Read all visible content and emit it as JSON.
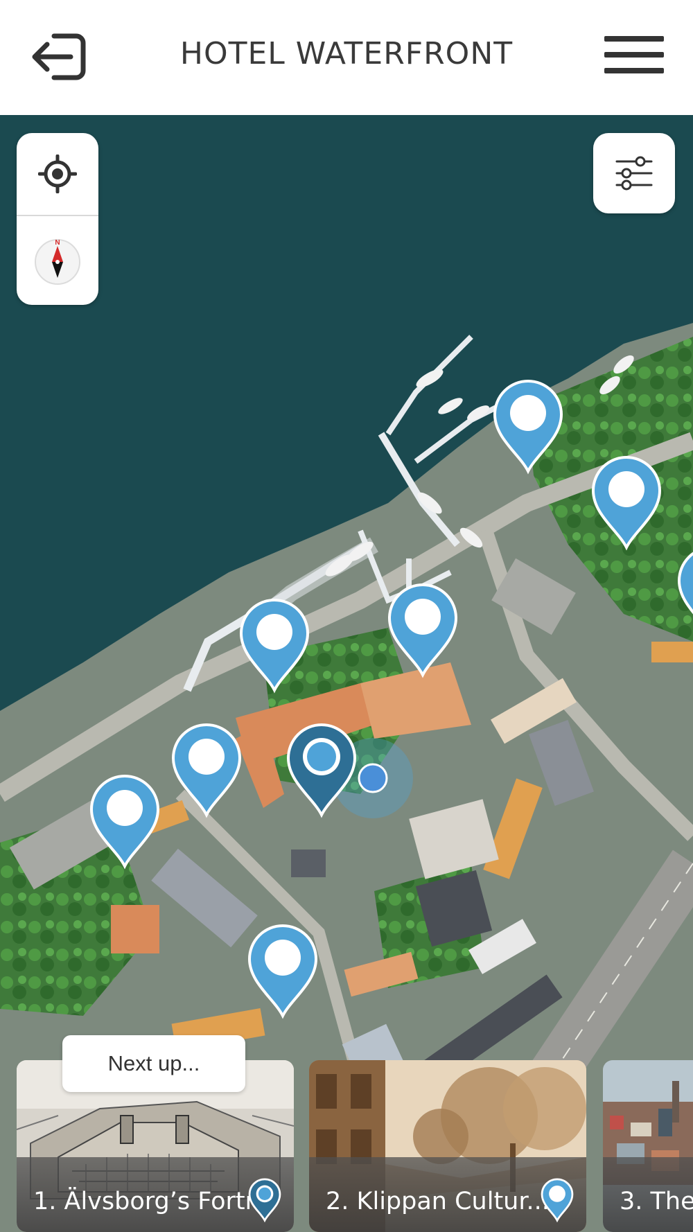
{
  "header": {
    "title": "HOTEL WATERFRONT",
    "back_icon": "exit-arrow-icon",
    "menu_icon": "hamburger-menu-icon"
  },
  "map_controls": {
    "locate_icon": "crosshair-locate-icon",
    "compass_icon": "compass-icon",
    "compass_north": "N",
    "filter_icon": "sliders-filter-icon"
  },
  "colors": {
    "pin_light": "#4fa3d8",
    "pin_dark": "#2e6f95",
    "water": "#1b4a50",
    "text_dark": "#3a3a3a"
  },
  "next_up": {
    "label": "Next up..."
  },
  "cards": [
    {
      "title": "1. Älvsborg’s Fortr..",
      "pin_style": "dark"
    },
    {
      "title": "2. Klippan Cultur...",
      "pin_style": "light"
    },
    {
      "title": "3. The",
      "pin_style": "light"
    }
  ]
}
